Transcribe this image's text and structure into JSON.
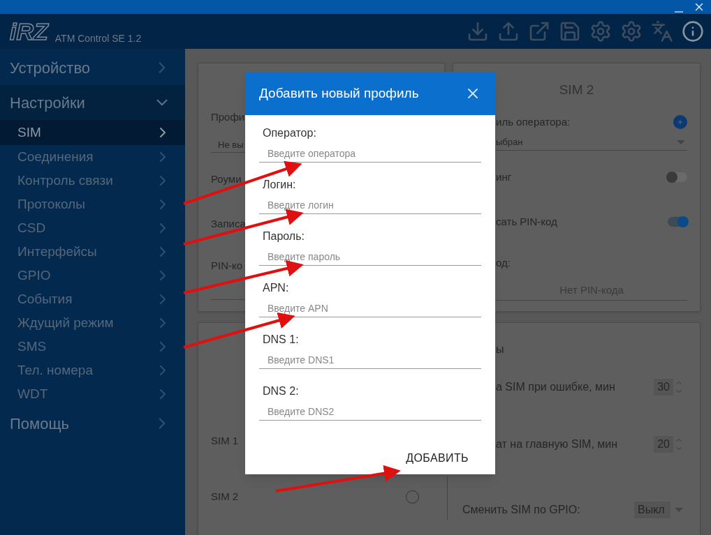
{
  "app": {
    "logo": "iRZ",
    "name": "ATM Control SE 1.2"
  },
  "sidebar": {
    "items": [
      {
        "label": "Устройство",
        "expanded": false
      },
      {
        "label": "Настройки",
        "expanded": true,
        "children": [
          {
            "label": "SIM",
            "selected": true
          },
          {
            "label": "Соединения",
            "selected": false
          },
          {
            "label": "Контроль связи",
            "selected": false
          },
          {
            "label": "Протоколы",
            "selected": false
          },
          {
            "label": "CSD",
            "selected": false
          },
          {
            "label": "Интерфейсы",
            "selected": false
          },
          {
            "label": "GPIO",
            "selected": false
          },
          {
            "label": "События",
            "selected": false
          },
          {
            "label": "Ждущий режим",
            "selected": false
          },
          {
            "label": "SMS",
            "selected": false
          },
          {
            "label": "Тел. номера",
            "selected": false
          },
          {
            "label": "WDT",
            "selected": false
          }
        ]
      },
      {
        "label": "Помощь",
        "expanded": false
      }
    ]
  },
  "sim1_card": {
    "profile_label": "Профи",
    "profile_value": "Не вы",
    "roaming_label": "Роуми",
    "write_pin_label": "Записа",
    "pin_label": "PIN-ко"
  },
  "sim2_card": {
    "title": "SIM 2",
    "profile_label": "иль оператора:",
    "profile_value": "ыбран",
    "roaming_label": "инг",
    "roaming_on": false,
    "write_pin_label": "сать PIN-код",
    "write_pin_on": true,
    "pin_label": "од:",
    "pin_value": "Нет PIN-кода"
  },
  "switch_card": {
    "title": "ы",
    "sims": [
      {
        "label": "SIM 1"
      },
      {
        "label": "SIM 2",
        "selected": false
      }
    ],
    "settings": [
      {
        "kind": "number",
        "label": "а SIM при ошибке, мин",
        "value": "30"
      },
      {
        "kind": "number",
        "label": "ат на главную SIM, мин",
        "value": "20"
      },
      {
        "kind": "select",
        "label": "Сменить SIM по GPIO:",
        "value": "Выкл"
      }
    ]
  },
  "dialog": {
    "title": "Добавить новый профиль",
    "fields": [
      {
        "label": "Оператор:",
        "placeholder": "Введите оператора"
      },
      {
        "label": "Логин:",
        "placeholder": "Введите логин"
      },
      {
        "label": "Пароль:",
        "placeholder": "Введите пароль"
      },
      {
        "label": "APN:",
        "placeholder": "Введите APN"
      },
      {
        "label": "DNS 1:",
        "placeholder": "Введите DNS1"
      },
      {
        "label": "DNS 2:",
        "placeholder": "Введите DNS2"
      }
    ],
    "button": "ДОБАВИТЬ"
  }
}
